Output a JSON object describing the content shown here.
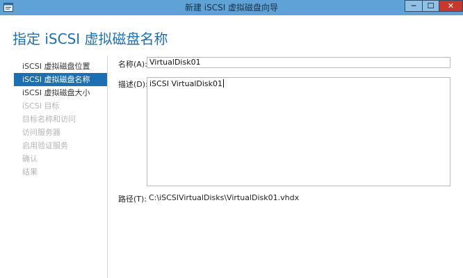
{
  "window": {
    "title": "新建 iSCSI 虚拟磁盘向导",
    "minimize_label": "─",
    "maximize_label": "☐",
    "close_label": "✕"
  },
  "page": {
    "heading": "指定 iSCSI 虚拟磁盘名称"
  },
  "nav": {
    "items": [
      {
        "label": "iSCSI 虚拟磁盘位置",
        "state": "normal"
      },
      {
        "label": "iSCSI 虚拟磁盘名称",
        "state": "selected"
      },
      {
        "label": "iSCSI 虚拟磁盘大小",
        "state": "normal"
      },
      {
        "label": "iSCSI 目标",
        "state": "disabled"
      },
      {
        "label": "目标名称和访问",
        "state": "disabled"
      },
      {
        "label": "访问服务器",
        "state": "disabled"
      },
      {
        "label": "启用验证服务",
        "state": "disabled"
      },
      {
        "label": "确认",
        "state": "disabled"
      },
      {
        "label": "结果",
        "state": "disabled"
      }
    ]
  },
  "form": {
    "name_label": "名称(A):",
    "name_value": "VirtualDisk01",
    "desc_label": "描述(D):",
    "desc_value": "iSCSI VirtualDisk01",
    "path_label": "路径(T):",
    "path_value": "C:\\iSCSIVirtualDisks\\VirtualDisk01.vhdx"
  },
  "colors": {
    "accent": "#1c6fb0",
    "titlebar": "#5ea2d6",
    "close": "#c7392f"
  },
  "icons": {
    "app": "wizard-window-icon"
  }
}
